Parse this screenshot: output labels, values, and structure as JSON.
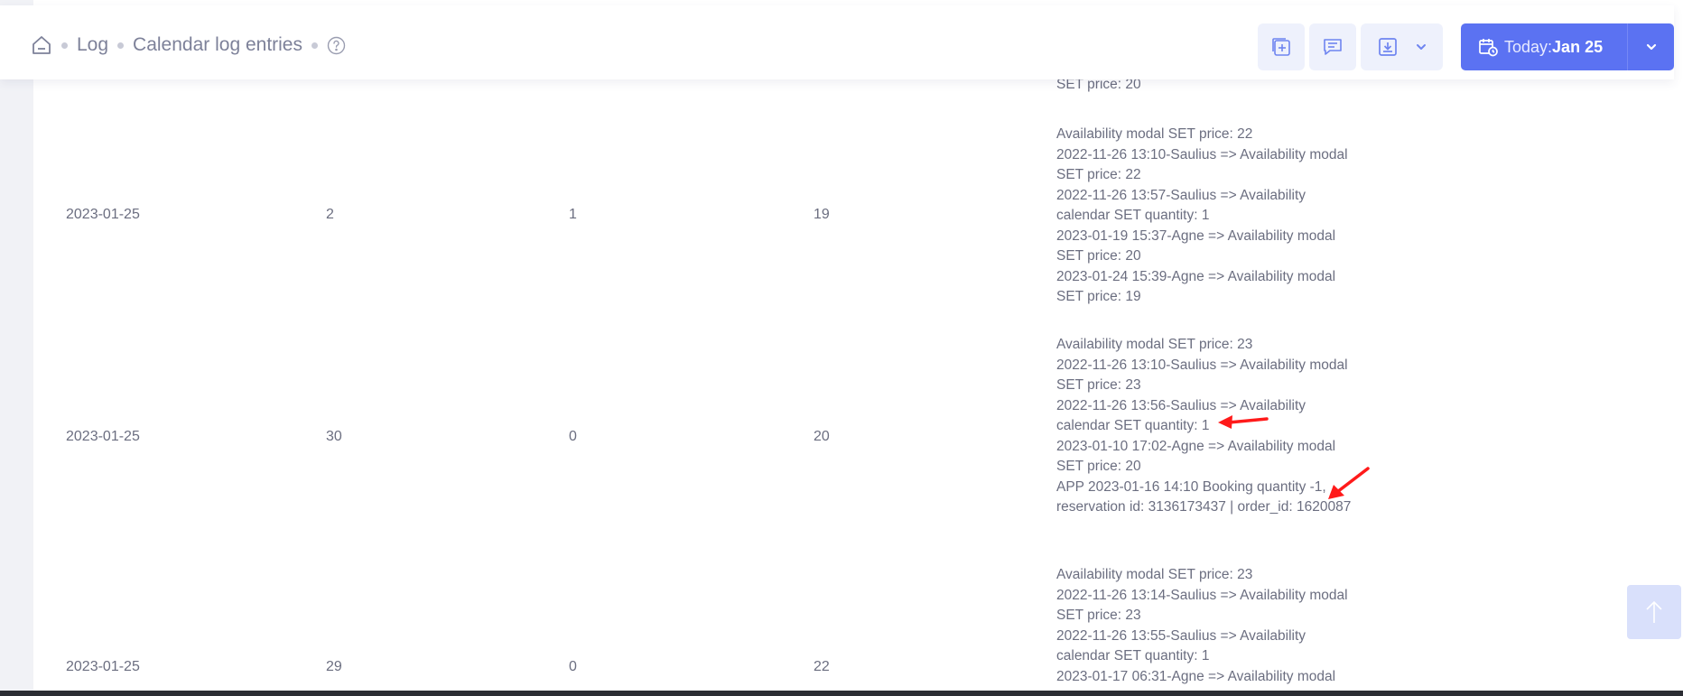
{
  "breadcrumb": {
    "items": [
      "Log",
      "Calendar log entries"
    ]
  },
  "today": {
    "label": "Today:",
    "value": "Jan 25"
  },
  "colors": {
    "accent": "#5b72f2",
    "tool_bg": "#eef1fc",
    "annotation": "#ff1a1a"
  },
  "icons": {
    "home": "home-icon",
    "help": "help-icon",
    "add": "add-box-icon",
    "comment": "comment-icon",
    "download": "download-icon",
    "calendar": "calendar-clock-icon",
    "chevron": "chevron-down-icon",
    "scroll": "arrow-up-icon"
  },
  "rows": [
    {
      "date": "",
      "c2": "",
      "c3": "",
      "c4": "",
      "log": [
        "SET price: 20"
      ]
    },
    {
      "date": "2023-01-25",
      "c2": "2",
      "c3": "1",
      "c4": "19",
      "log": [
        "Availability modal SET price: 22",
        "2022-11-26 13:10-Saulius => Availability modal",
        "SET price: 22",
        "2022-11-26 13:57-Saulius => Availability",
        "calendar SET quantity: 1",
        "2023-01-19 15:37-Agne => Availability modal",
        "SET price: 20",
        "2023-01-24 15:39-Agne => Availability modal",
        "SET price: 19"
      ]
    },
    {
      "date": "2023-01-25",
      "c2": "30",
      "c3": "0",
      "c4": "20",
      "log": [
        "Availability modal SET price: 23",
        "2022-11-26 13:10-Saulius => Availability modal",
        "SET price: 23",
        "2022-11-26 13:56-Saulius => Availability",
        "calendar SET quantity: 1",
        "2023-01-10 17:02-Agne => Availability modal",
        "SET price: 20",
        "APP 2023-01-16 14:10 Booking quantity -1,",
        "reservation id: 3136173437 | order_id: 1620087"
      ]
    },
    {
      "date": "2023-01-25",
      "c2": "29",
      "c3": "0",
      "c4": "22",
      "log": [
        "Availability modal SET price: 23",
        "2022-11-26 13:14-Saulius => Availability modal",
        "SET price: 23",
        "2022-11-26 13:55-Saulius => Availability",
        "calendar SET quantity: 1",
        "2023-01-17 06:31-Agne => Availability modal"
      ]
    }
  ]
}
